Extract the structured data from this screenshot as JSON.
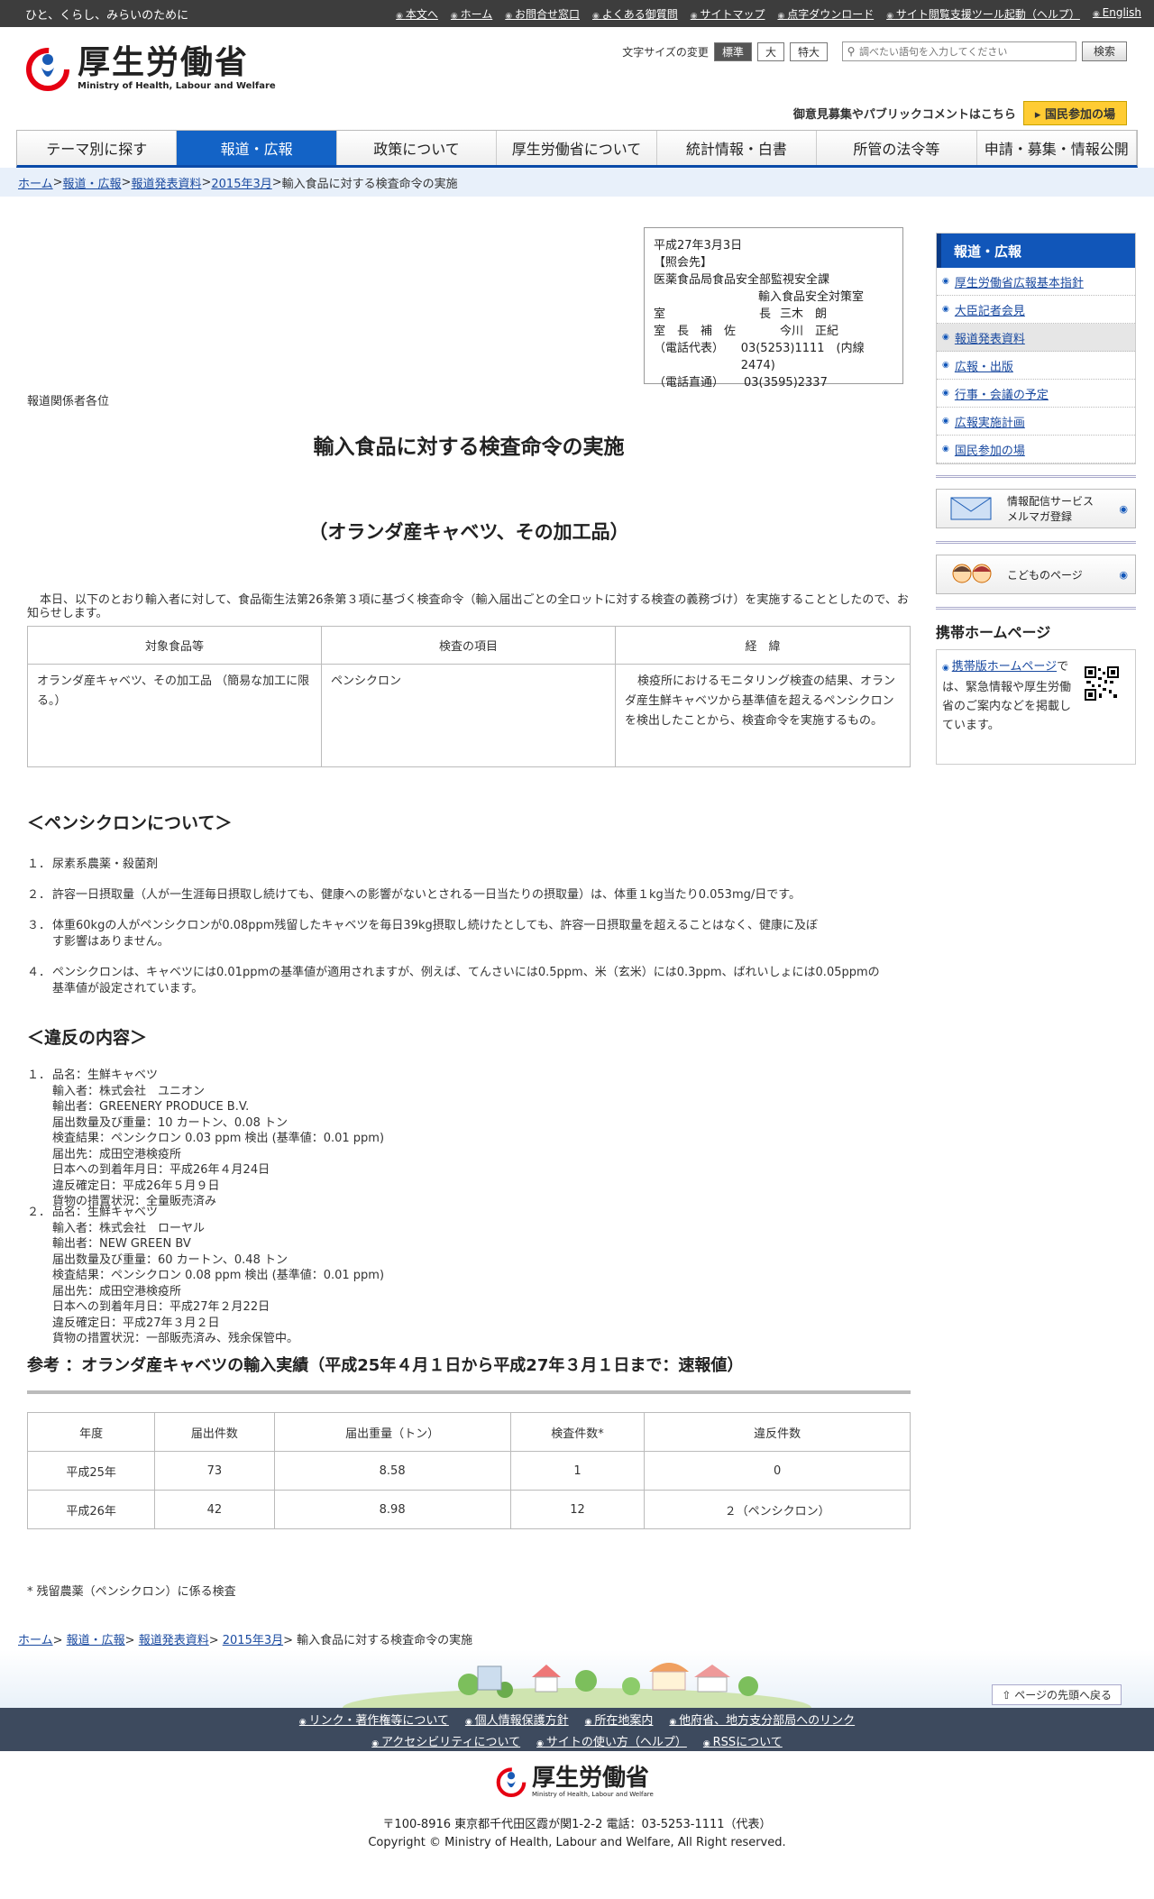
{
  "topbar": {
    "tagline": "ひと、くらし、みらいのために",
    "links": [
      "本文へ",
      "ホーム",
      "お問合せ窓口",
      "よくある御質問",
      "サイトマップ",
      "点字ダウンロード",
      "サイト閲覧支援ツール起動（ヘルプ）",
      "English"
    ]
  },
  "header": {
    "logo_jp": "厚生労働省",
    "logo_en": "Ministry of Health, Labour and Welfare",
    "fontsize_label": "文字サイズの変更",
    "fontsize_options": [
      "標準",
      "大",
      "特大"
    ],
    "search_placeholder": "調べたい語句を入力してください",
    "search_button": "検索",
    "comment_text": "御意見募集やパブリックコメントはこちら",
    "kokumin_button": "国民参加の場"
  },
  "nav": [
    "テーマ別に探す",
    "報道・広報",
    "政策について",
    "厚生労働省について",
    "統計情報・白書",
    "所管の法令等",
    "申請・募集・情報公開"
  ],
  "breadcrumb": [
    "ホーム",
    "報道・広報",
    "報道発表資料",
    "2015年3月",
    "輸入食品に対する検査命令の実施"
  ],
  "contact": {
    "date": "平成27年3月3日",
    "heading": "【照会先】",
    "dept": "医薬食品局食品安全部監視安全課",
    "office": "輸入食品安全対策室",
    "chief_title": "室　　　　　　　　長",
    "chief_name": "三木　朗",
    "deputy_title": "室　長　補　佐",
    "deputy_name": "今川　正紀",
    "tel_rep_label": "（電話代表）",
    "tel_rep": "03(5253)1111　(内線2474)",
    "tel_direct_label": "（電話直通）",
    "tel_direct": "03(3595)2337"
  },
  "article": {
    "addressee": "報道関係者各位",
    "title": "輸入食品に対する検査命令の実施",
    "subtitle": "（オランダ産キャベツ、その加工品）",
    "intro": "本日、以下のとおり輸入者に対して、食品衛生法第26条第３項に基づく検査命令（輸入届出ごとの全ロットに対する検査の義務づけ）を実施することとしたので、お知らせします。",
    "table_headers": [
      "対象食品等",
      "検査の項目",
      "経　緯"
    ],
    "table_row": [
      "オランダ産キャベツ、その加工品 （簡易な加工に限る。）",
      "ペンシクロン",
      "検疫所におけるモニタリング検査の結果、オランダ産生鮮キャベツから基準値を超えるペンシクロンを検出したことから、検査命令を実施するもの。"
    ],
    "pencycuron_heading": "＜ペンシクロンについて＞",
    "pencycuron_items": [
      {
        "num": "１．",
        "text": "尿素系農薬・殺菌剤"
      },
      {
        "num": "２．",
        "text": "許容一日摂取量（人が一生涯毎日摂取し続けても、健康への影響がないとされる一日当たりの摂取量）は、体重１kg当たり0.053mg/日です。"
      },
      {
        "num": "３．",
        "text": "体重60kgの人がペンシクロンが0.08ppm残留したキャベツを毎日39kg摂取し続けたとしても、許容一日摂取量を超えることはなく、健康に及ぼす影響はありません。"
      },
      {
        "num": "４．",
        "text": "ペンシクロンは、キャベツには0.01ppmの基準値が適用されますが、例えば、てんさいには0.5ppm、米（玄米）には0.3ppm、ばれいしょには0.05ppmの基準値が設定されています。"
      }
    ],
    "violation_heading": "＜違反の内容＞",
    "violations": [
      {
        "num": "１．",
        "lines": [
          "品名：生鮮キャベツ",
          "輸入者：株式会社　ユニオン",
          "輸出者：GREENERY PRODUCE B.V.",
          "届出数量及び重量：10 カートン、0.08 トン",
          "検査結果：ペンシクロン 0.03 ppm 検出 (基準値：0.01 ppm)",
          "届出先：成田空港検疫所",
          "日本への到着年月日：平成26年４月24日",
          "違反確定日：平成26年５月９日",
          "貨物の措置状況：全量販売済み"
        ]
      },
      {
        "num": "２．",
        "lines": [
          "品名：生鮮キャベツ",
          "輸入者：株式会社　ローヤル",
          "輸出者：NEW GREEN BV",
          "届出数量及び重量：60 カートン、0.48 トン",
          "検査結果：ペンシクロン 0.08 ppm 検出 (基準値：0.01 ppm)",
          "届出先：成田空港検疫所",
          "日本への到着年月日：平成27年２月22日",
          "違反確定日：平成27年３月２日",
          "貨物の措置状況：一部販売済み、残余保管中。"
        ]
      }
    ],
    "ref_title": "参考 ：オランダ産キャベツの輸入実績（平成25年４月１日から平成27年３月１日まで：速報値）",
    "ref_headers": [
      "年度",
      "届出件数",
      "届出重量（トン）",
      "検査件数*",
      "違反件数"
    ],
    "ref_rows": [
      [
        "平成25年",
        "73",
        "8.58",
        "1",
        "0"
      ],
      [
        "平成26年",
        "42",
        "8.98",
        "12",
        "２（ペンシクロン）"
      ]
    ],
    "note": "* 残留農薬（ペンシクロン）に係る検査"
  },
  "sidebar": {
    "heading": "報道・広報",
    "items": [
      "厚生労働省広報基本指針",
      "大臣記者会見",
      "報道発表資料",
      "広報・出版",
      "行事・会議の予定",
      "広報実施計画",
      "国民参加の場"
    ],
    "banner_mail": [
      "情報配信サービス",
      "メルマガ登録"
    ],
    "banner_kids": "こどものページ",
    "mobile_heading": "携帯ホームページ",
    "mobile_link": "携帯版ホームページ",
    "mobile_text": "では、緊急情報や厚生労働省のご案内などを掲載しています。"
  },
  "footer": {
    "pagetop": "ページの先頭へ戻る",
    "links_row1": [
      "リンク・著作権等について",
      "個人情報保護方針",
      "所在地案内",
      "他府省、地方支分部局へのリンク"
    ],
    "links_row2": [
      "アクセシビリティについて",
      "サイトの使い方（ヘルプ）",
      "RSSについて"
    ],
    "logo_jp": "厚生労働省",
    "logo_en": "Ministry of Health, Labour and Welfare",
    "address": "〒100-8916 東京都千代田区霞が関1-2-2 電話：03-5253-1111（代表）",
    "copyright": "Copyright © Ministry of Health, Labour and Welfare, All Right reserved."
  }
}
